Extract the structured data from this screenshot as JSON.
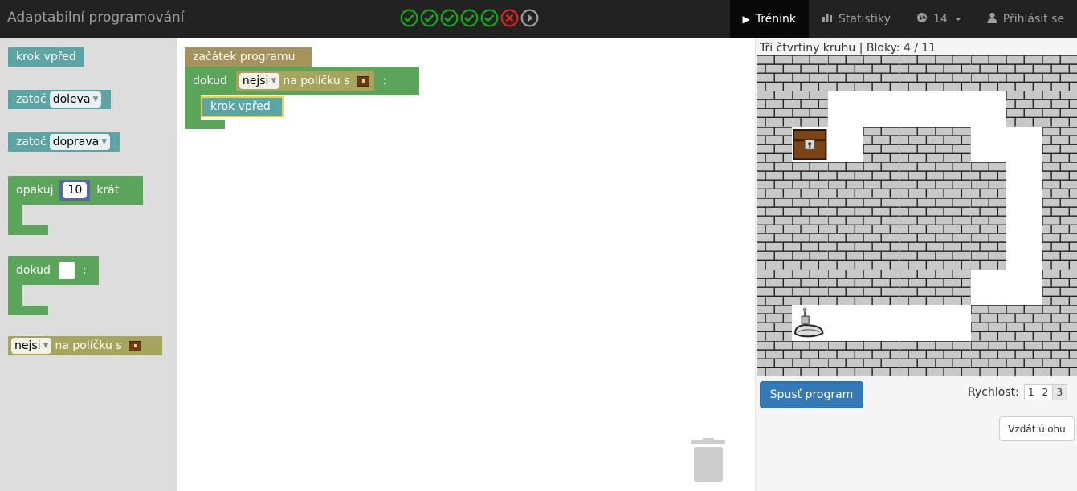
{
  "app": {
    "title": "Adaptabilní programování"
  },
  "progress": {
    "items": [
      {
        "state": "success",
        "icon": "check-circle-icon"
      },
      {
        "state": "success",
        "icon": "check-circle-icon"
      },
      {
        "state": "success",
        "icon": "check-circle-icon"
      },
      {
        "state": "success",
        "icon": "check-circle-icon"
      },
      {
        "state": "success",
        "icon": "check-circle-icon"
      },
      {
        "state": "failure",
        "icon": "x-circle-icon"
      },
      {
        "state": "current",
        "icon": "play-circle-icon"
      }
    ],
    "colors": {
      "success": "#1aa31a",
      "failure": "#d9231c",
      "current": "#999999"
    }
  },
  "nav": {
    "training": "Trénink",
    "stats": "Statistiky",
    "level": "14",
    "login": "Přihlásit se"
  },
  "toolbox": {
    "forward": "krok vpřed",
    "turn": "zatoč",
    "left": "doleva",
    "right": "doprava",
    "repeat": "opakuj",
    "repeat_count": "10",
    "times": "krát",
    "while": "dokud",
    "colon": ":",
    "not": "nejsi",
    "on_tile": "na políčku s"
  },
  "workspace": {
    "start": "začátek programu",
    "while": "dokud",
    "not": "nejsi",
    "on_tile": "na políčku s",
    "colon": ":",
    "forward": "krok vpřed"
  },
  "task": {
    "header": "Tři čtvrtiny kruhu | Bloky: 4 / 11",
    "run_button": "Spusť program",
    "speed_label": "Rychlost:",
    "speeds": [
      "1",
      "2",
      "3"
    ],
    "selected_speed": "3",
    "give_up_button": "Vzdát úlohu"
  },
  "maze": {
    "rows": 9,
    "cols": 9,
    "free": [
      [
        1,
        2
      ],
      [
        1,
        3
      ],
      [
        1,
        4
      ],
      [
        1,
        5
      ],
      [
        1,
        6
      ],
      [
        2,
        2
      ],
      [
        2,
        6
      ],
      [
        2,
        7
      ],
      [
        3,
        7
      ],
      [
        4,
        7
      ],
      [
        5,
        7
      ],
      [
        6,
        6
      ],
      [
        6,
        7
      ],
      [
        7,
        1
      ],
      [
        7,
        2
      ],
      [
        7,
        3
      ],
      [
        7,
        4
      ],
      [
        7,
        5
      ]
    ],
    "goal": [
      2,
      1
    ],
    "robot": [
      7,
      1
    ]
  },
  "colors": {
    "navbar": "#222222",
    "block_move": "#5ba5a5",
    "block_loop": "#5ba55b",
    "block_condition": "#a5a55b",
    "block_start": "#a5935b",
    "primary": "#337ab7"
  }
}
